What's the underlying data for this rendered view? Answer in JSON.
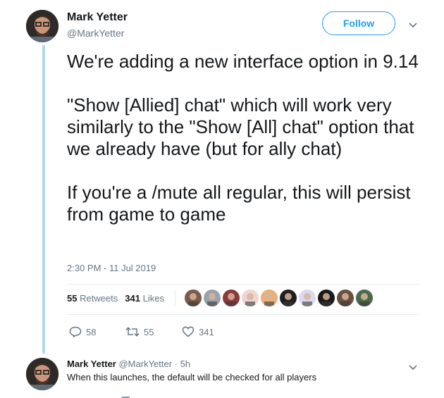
{
  "tweet": {
    "author_name": "Mark Yetter",
    "author_handle": "@MarkYetter",
    "follow_label": "Follow",
    "text": [
      "We're adding a new interface option in 9.14",
      "\"Show [Allied] chat\" which will work very similarly to the \"Show [All] chat\" option that we already have (but for ally chat)",
      "If you're a /mute all regular, this will persist from game to game"
    ],
    "timestamp": "2:30 PM - 11 Jul 2019",
    "retweets_count": "55",
    "retweets_label": "Retweets",
    "likes_count": "341",
    "likes_label": "Likes",
    "liker_avatar_colors": [
      "#7a5a48",
      "#9aa3ad",
      "#8a3a3a",
      "#f0d4d4",
      "#e8b07a",
      "#1f1f1f",
      "#d9d9f0",
      "#1a1a1a",
      "#6b5040",
      "#4a6a4a"
    ],
    "actions": {
      "replies": "58",
      "retweets": "55",
      "likes": "341"
    }
  },
  "reply": {
    "author_name": "Mark Yetter",
    "author_handle": "@MarkYetter",
    "time": "5h",
    "text": "When this launches, the default will be checked for all players"
  },
  "colors": {
    "accent": "#1da1f2",
    "thread_line": "#b5d8f0",
    "muted": "#657786"
  }
}
